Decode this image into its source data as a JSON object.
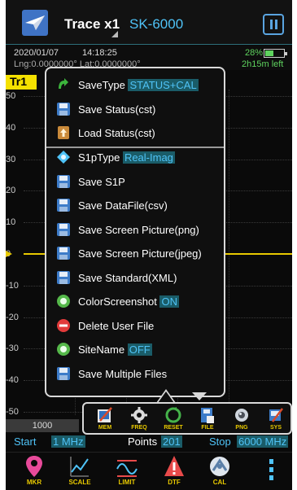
{
  "header": {
    "trace_label": "Trace x1",
    "model": "SK-6000"
  },
  "status": {
    "date": "2020/01/07",
    "time": "14:18:25",
    "gps": "Lng:0.0000000°  Lat:0.0000000°",
    "battery": "28%",
    "time_left": "2h15m left"
  },
  "trace_tag": "Tr1",
  "chart_data": {
    "type": "line",
    "yticks": [
      "50",
      "40",
      "30",
      "20",
      "10",
      "0",
      "-10",
      "-20",
      "-30",
      "-40",
      "-50"
    ],
    "ylim": [
      -50,
      50
    ],
    "x_first_tick": "1000",
    "series": [
      {
        "values": [
          0,
          0
        ]
      }
    ]
  },
  "menu": {
    "items": [
      {
        "label": "SaveType ",
        "value": "STATUS+CAL",
        "icon": "savetype-icon"
      },
      {
        "label": "Save Status(cst)",
        "icon": "save-icon"
      },
      {
        "label": "Load Status(cst)",
        "icon": "load-icon"
      },
      {
        "label": "S1pType ",
        "value": "Real-Imag",
        "icon": "s1p-type-icon"
      },
      {
        "label": "Save S1P",
        "icon": "save-icon"
      },
      {
        "label": "Save DataFile(csv)",
        "icon": "save-icon"
      },
      {
        "label": "Save Screen Picture(png)",
        "icon": "save-icon"
      },
      {
        "label": "Save Screen Picture(jpeg)",
        "icon": "save-icon"
      },
      {
        "label": "Save Standard(XML)",
        "icon": "save-icon"
      },
      {
        "label": "ColorScreenshot ",
        "value": "ON",
        "icon": "toggle-icon"
      },
      {
        "label": "Delete User File",
        "icon": "delete-icon"
      },
      {
        "label": "SiteName ",
        "value": "OFF",
        "icon": "toggle-icon"
      },
      {
        "label": "Save Multiple Files",
        "icon": "save-icon"
      }
    ]
  },
  "toolbar": {
    "items": [
      {
        "label": "MEM",
        "icon": "memory-icon"
      },
      {
        "label": "FREQ",
        "icon": "frequency-icon"
      },
      {
        "label": "RESET",
        "icon": "reset-icon"
      },
      {
        "label": "FILE",
        "icon": "file-icon"
      },
      {
        "label": "PNG",
        "icon": "png-icon"
      },
      {
        "label": "SYS",
        "icon": "system-icon"
      }
    ]
  },
  "footer": {
    "start_label": "Start",
    "start_value": "1 MHz",
    "points_label": "Points",
    "points_value": "201",
    "stop_label": "Stop",
    "stop_value": "6000 MHz"
  },
  "bottom_bar": {
    "items": [
      {
        "label": "MKR",
        "icon": "marker-icon"
      },
      {
        "label": "SCALE",
        "icon": "scale-icon"
      },
      {
        "label": "LIMIT",
        "icon": "limit-icon"
      },
      {
        "label": "DTF",
        "icon": "dtf-icon"
      },
      {
        "label": "CAL",
        "icon": "calibration-icon"
      }
    ]
  },
  "colors": {
    "accent": "#4fc3f7",
    "trace": "#e8c900",
    "value_bg": "#1a5c68"
  }
}
